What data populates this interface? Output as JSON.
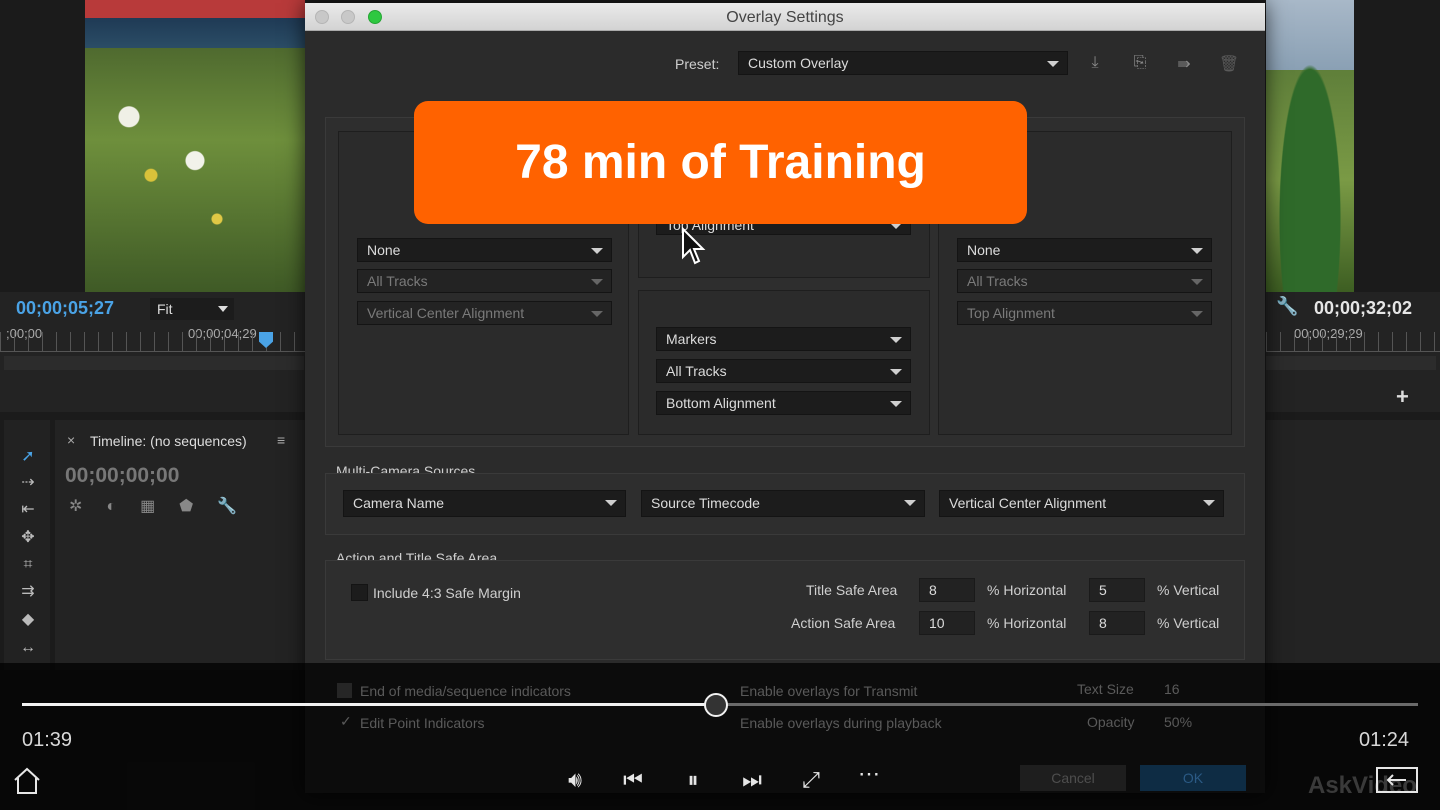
{
  "dialog": {
    "title": "Overlay Settings",
    "preset_label": "Preset:",
    "preset_value": "Custom Overlay",
    "icons": [
      "save-preset-icon",
      "import-preset-icon",
      "export-preset-icon",
      "delete-preset-icon"
    ]
  },
  "source": {
    "timecode": "00;00;05;27",
    "fit": "Fit",
    "ruler_start": ";00;00",
    "ruler_mark": "00;00;04;29"
  },
  "program": {
    "timecode": "00;00;32;02",
    "ruler_mark": "00;00;29;29"
  },
  "timeline": {
    "title": "Timeline: (no sequences)",
    "timecode": "00;00;00;00"
  },
  "left_column": {
    "source": "None",
    "tracks": "All Tracks",
    "alignment": "Vertical Center Alignment"
  },
  "middle_top": {
    "alignment": "Top Alignment"
  },
  "middle_bottom": {
    "source": "Markers",
    "tracks": "All Tracks",
    "alignment": "Bottom Alignment"
  },
  "right_column": {
    "source": "None",
    "tracks": "All Tracks",
    "alignment": "Top Alignment"
  },
  "multicam": {
    "heading": "Multi-Camera Sources",
    "name": "Camera Name",
    "timecode": "Source Timecode",
    "alignment": "Vertical Center Alignment"
  },
  "safe_area": {
    "heading": "Action and Title Safe Area",
    "include_label": "Include 4:3 Safe Margin",
    "title_label": "Title Safe Area",
    "title_h": "8",
    "title_v": "5",
    "action_label": "Action Safe Area",
    "action_h": "10",
    "action_v": "8",
    "h_unit": "% Horizontal",
    "v_unit": "% Vertical"
  },
  "options": {
    "end_media": "End of media/sequence indicators",
    "edit_point": "Edit Point Indicators",
    "transmit": "Enable overlays for Transmit",
    "playback": "Enable overlays during playback",
    "text_size_label": "Text Size",
    "text_size": "16",
    "opacity_label": "Opacity",
    "opacity": "50%",
    "cancel": "Cancel",
    "ok": "OK"
  },
  "promo": {
    "text": "78 min of Training"
  },
  "player": {
    "elapsed": "01:39",
    "remaining": "01:24",
    "progress": 0.497,
    "watermark": "AskVideo"
  }
}
